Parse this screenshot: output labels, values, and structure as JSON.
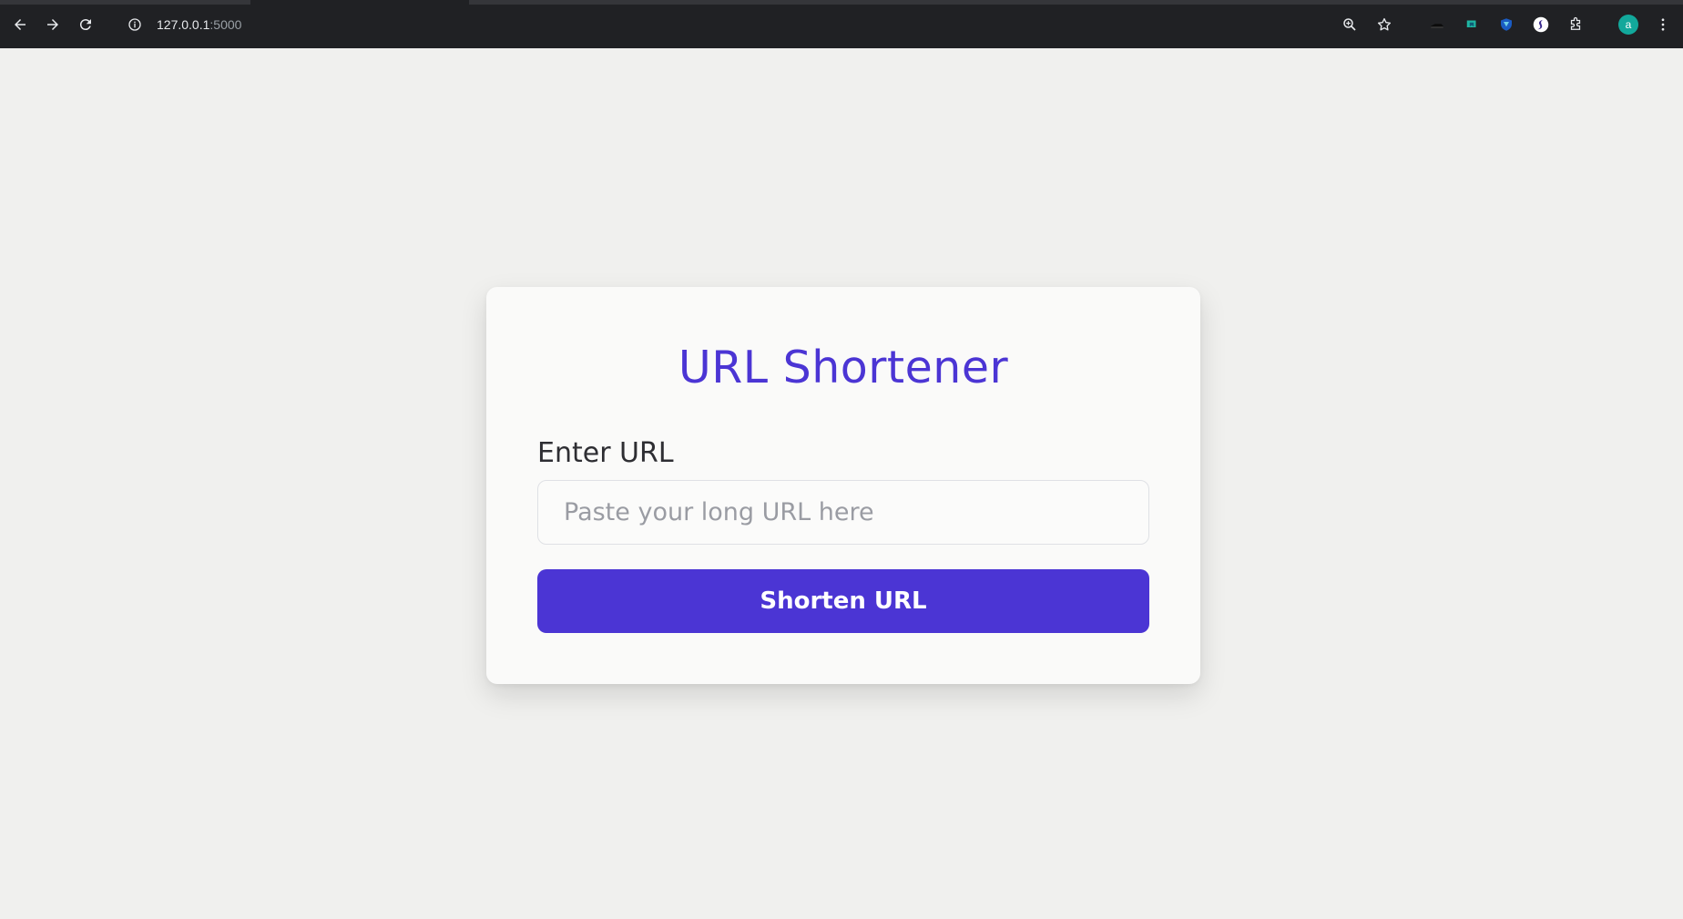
{
  "browser": {
    "url_host": "127.0.0.1",
    "url_port": ":5000",
    "profile_initial": "a"
  },
  "card": {
    "title": "URL Shortener",
    "field_label": "Enter URL",
    "input_placeholder": "Paste your long URL here",
    "input_value": "",
    "button_label": "Shorten URL"
  },
  "colors": {
    "accent": "#4b35d4",
    "page_bg": "#f0f0ee",
    "card_bg": "#fafaf9",
    "toolbar_bg": "#202124"
  }
}
